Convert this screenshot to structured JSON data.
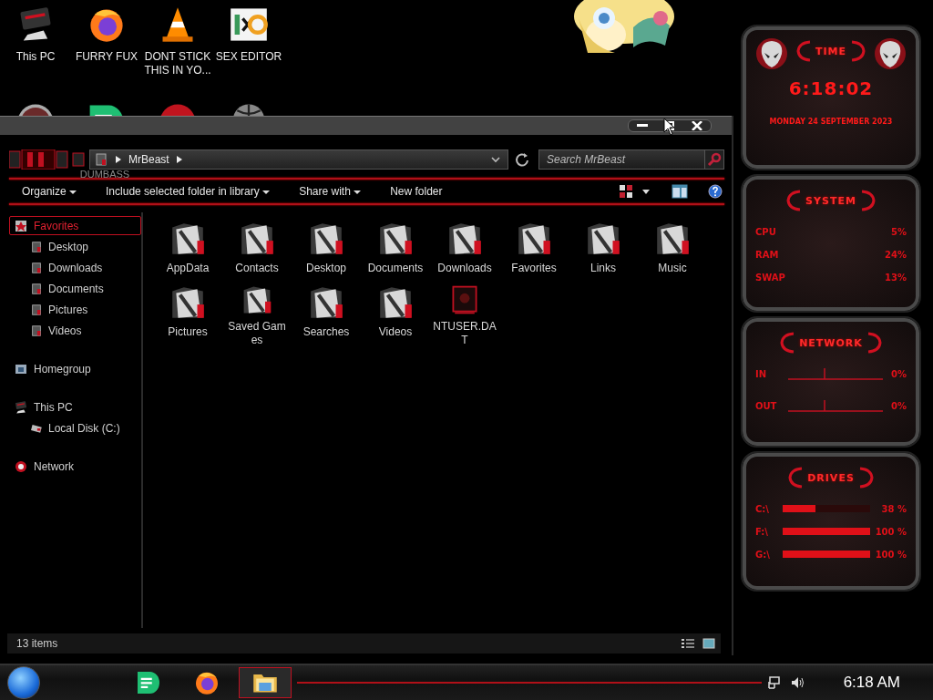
{
  "desktop": {
    "icons": [
      {
        "label": "This PC",
        "kind": "pc"
      },
      {
        "label": "FURRY FUX",
        "kind": "firefox"
      },
      {
        "label": "DONT STICK THIS IN YO...",
        "kind": "cone"
      },
      {
        "label": "SEX EDITOR",
        "kind": "hex"
      }
    ],
    "icons_behind": [
      {
        "kind": "disc"
      },
      {
        "kind": "notes",
        "label": "DUMBASS"
      },
      {
        "kind": "dev"
      },
      {
        "kind": "globe"
      }
    ]
  },
  "explorer": {
    "path": [
      "MrBeast"
    ],
    "search": {
      "placeholder": "Search MrBeast"
    },
    "toolbar": [
      {
        "label": "Organize",
        "menu": true
      },
      {
        "label": "Include selected folder in library",
        "menu": true
      },
      {
        "label": "Share with",
        "menu": true
      },
      {
        "label": "New folder",
        "menu": false
      }
    ],
    "nav": [
      {
        "label": "Favorites",
        "selected": true,
        "children": [
          {
            "label": "Desktop",
            "selected": false
          },
          {
            "label": "Downloads",
            "selected": false
          },
          {
            "label": "Documents",
            "selected": false
          },
          {
            "label": "Pictures",
            "selected": false
          },
          {
            "label": "Videos",
            "selected": false
          }
        ]
      },
      {
        "label": "Homegroup",
        "selected": false
      },
      {
        "label": "This PC",
        "selected": false,
        "children": [
          {
            "label": "Local Disk (C:)",
            "selected": false
          }
        ]
      },
      {
        "label": "Network",
        "selected": false
      }
    ],
    "items": [
      {
        "label": "AppData",
        "kind": "folder"
      },
      {
        "label": "Contacts",
        "kind": "folder"
      },
      {
        "label": "Desktop",
        "kind": "folder"
      },
      {
        "label": "Documents",
        "kind": "folder"
      },
      {
        "label": "Downloads",
        "kind": "folder"
      },
      {
        "label": "Favorites",
        "kind": "folder"
      },
      {
        "label": "Links",
        "kind": "folder"
      },
      {
        "label": "Music",
        "kind": "folder"
      },
      {
        "label": "Pictures",
        "kind": "folder"
      },
      {
        "label": "Saved Games",
        "kind": "folder"
      },
      {
        "label": "Searches",
        "kind": "folder"
      },
      {
        "label": "Videos",
        "kind": "folder"
      },
      {
        "label": "NTUSER.DAT",
        "kind": "file"
      }
    ],
    "status": "13 items"
  },
  "gadgets": [
    {
      "kind": "clock",
      "title": "TIME",
      "time": "6:18:02",
      "date": "MONDAY 24 SEPTEMBER 2023"
    },
    {
      "kind": "stats",
      "title": "SYSTEM",
      "rows": [
        {
          "label": "CPU",
          "value": "5%"
        },
        {
          "label": "RAM",
          "value": "24%"
        },
        {
          "label": "SWAP",
          "value": "13%"
        }
      ]
    },
    {
      "kind": "network",
      "title": "NETWORK",
      "rows": [
        {
          "label": "IN",
          "value": "0%"
        },
        {
          "label": "OUT",
          "value": "0%"
        }
      ]
    },
    {
      "kind": "drives",
      "title": "DRIVES",
      "rows": [
        {
          "label": "C:\\",
          "level": 0.38,
          "value": "38 %"
        },
        {
          "label": "F:\\",
          "level": 1,
          "value": "100 %"
        },
        {
          "label": "G:\\",
          "level": 1,
          "value": "100 %"
        }
      ]
    }
  ],
  "taskbar": {
    "apps": [
      {
        "kind": "notes",
        "selected": false
      },
      {
        "kind": "firefox",
        "selected": false
      },
      {
        "kind": "explorer",
        "selected": true
      }
    ],
    "clock": "6:18 AM"
  }
}
